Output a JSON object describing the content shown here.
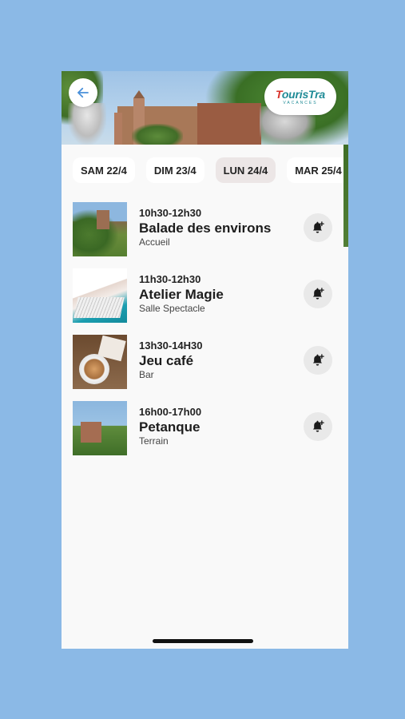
{
  "header": {
    "back_icon": "arrow-left-icon",
    "logo": {
      "main_t": "T",
      "main_rest": "ourisTra",
      "sub": "VACANCES"
    }
  },
  "days": [
    {
      "label": "SAM 22/4",
      "active": false
    },
    {
      "label": "DIM 23/4",
      "active": false
    },
    {
      "label": "LUN 24/4",
      "active": true
    },
    {
      "label": "MAR 25/4",
      "active": false
    }
  ],
  "activities": [
    {
      "time": "10h30-12h30",
      "title": "Balade des environs",
      "place": "Accueil",
      "thumb": "castle-garden-photo",
      "action_icon": "bell-plus-icon"
    },
    {
      "time": "11h30-12h30",
      "title": "Atelier Magie",
      "place": "Salle Spectacle",
      "thumb": "card-fan-photo",
      "action_icon": "bell-plus-icon"
    },
    {
      "time": "13h30-14H30",
      "title": "Jeu café",
      "place": "Bar",
      "thumb": "coffee-cup-photo",
      "action_icon": "bell-plus-icon"
    },
    {
      "time": "16h00-17h00",
      "title": "Petanque",
      "place": "Terrain",
      "thumb": "castle-grounds-photo",
      "action_icon": "bell-plus-icon"
    }
  ],
  "colors": {
    "background": "#8bb9e6",
    "accent_back": "#4a90d9",
    "logo_teal": "#1f8b96",
    "logo_red": "#d9332b",
    "active_tab": "#ece6e6"
  }
}
